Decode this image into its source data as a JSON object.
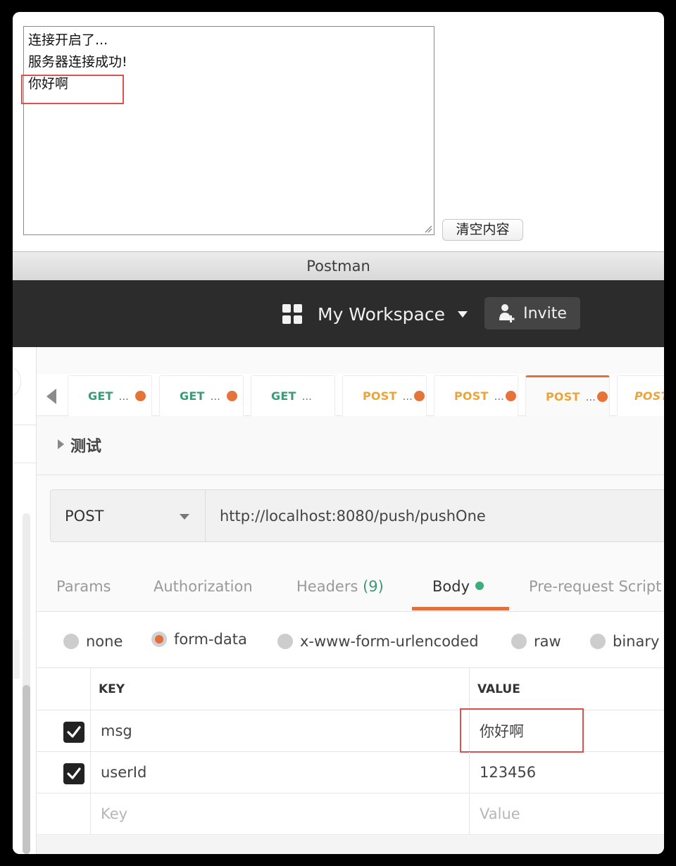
{
  "browser_page": {
    "log_lines": [
      "连接开启了...",
      "服务器连接成功!",
      "你好啊"
    ],
    "clear_button_label": "清空内容"
  },
  "window": {
    "title": "Postman"
  },
  "header": {
    "workspace_icon": "grid-icon",
    "workspace_name": "My Workspace",
    "invite_label": "Invite",
    "invite_icon": "add-user-icon"
  },
  "request_tabs": [
    {
      "method": "GET",
      "ellipsis": "...",
      "unsaved": true,
      "active": false
    },
    {
      "method": "GET",
      "ellipsis": "...",
      "unsaved": true,
      "active": false
    },
    {
      "method": "GET",
      "ellipsis": "...",
      "unsaved": false,
      "active": false
    },
    {
      "method": "POST",
      "ellipsis": "...",
      "unsaved": true,
      "active": false
    },
    {
      "method": "POST",
      "ellipsis": "...",
      "unsaved": true,
      "active": false
    },
    {
      "method": "POST",
      "ellipsis": "...",
      "unsaved": true,
      "active": true
    },
    {
      "method": "POST",
      "ellipsis": "",
      "unsaved": false,
      "active": false
    }
  ],
  "collection": {
    "name": "测试"
  },
  "request": {
    "method": "POST",
    "url": "http://localhost:8080/push/pushOne"
  },
  "request_sections": {
    "params": "Params",
    "authorization": "Authorization",
    "headers": "Headers",
    "headers_count": "(9)",
    "body": "Body",
    "pre_request": "Pre-request Script",
    "active": "Body"
  },
  "body_types": {
    "options": [
      "none",
      "form-data",
      "x-www-form-urlencoded",
      "raw",
      "binary"
    ],
    "selected": "form-data"
  },
  "form_data": {
    "columns": [
      "KEY",
      "VALUE"
    ],
    "rows": [
      {
        "checked": true,
        "key": "msg",
        "value": "你好啊"
      },
      {
        "checked": true,
        "key": "userId",
        "value": "123456"
      }
    ],
    "new_row_placeholders": {
      "key": "Key",
      "value": "Value"
    }
  },
  "colors": {
    "accent": "#e36f3d",
    "get_method": "#3c9a75",
    "post_method": "#e9a43c",
    "highlight_box": "#d9534f",
    "header_bg": "#2c2c2c"
  }
}
